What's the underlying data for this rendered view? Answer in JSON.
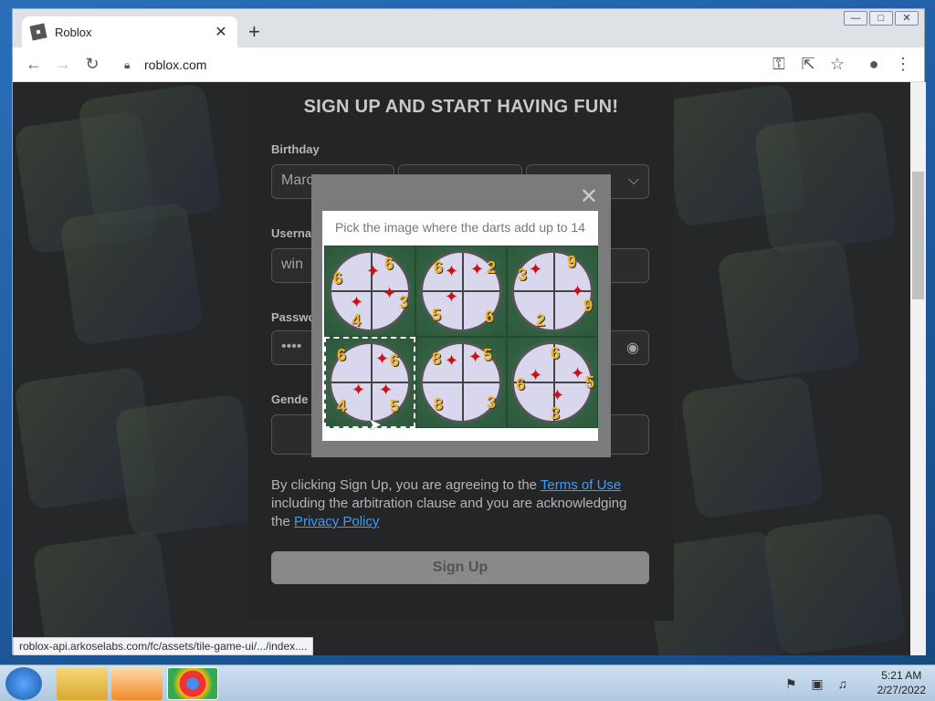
{
  "browser": {
    "tab_title": "Roblox",
    "url": "roblox.com",
    "status_url": "roblox-api.arkoselabs.com/fc/assets/tile-game-ui/.../index...."
  },
  "signup": {
    "heading": "SIGN UP AND START HAVING FUN!",
    "birthday_label": "Birthday",
    "birthday_month": "Marc",
    "username_label": "Userna",
    "username_value": "win",
    "password_label": "Passwo",
    "password_value": "••••",
    "gender_label": "Gende",
    "terms_before": "By clicking Sign Up, you are agreeing to the ",
    "terms_link": "Terms of Use",
    "terms_mid": " including the arbitration clause and you are acknowledging the ",
    "privacy_link": "Privacy Policy",
    "signup_button": "Sign Up"
  },
  "captcha": {
    "prompt": "Pick the image where the darts add up to 14",
    "close": "✕",
    "tiles": [
      {
        "numbers": [
          "6",
          "6",
          "3",
          "4"
        ]
      },
      {
        "numbers": [
          "6",
          "2",
          "5",
          "6"
        ]
      },
      {
        "numbers": [
          "3",
          "9",
          "9",
          "2"
        ]
      },
      {
        "numbers": [
          "6",
          "6",
          "4",
          "5"
        ]
      },
      {
        "numbers": [
          "8",
          "5",
          "8",
          "3"
        ]
      },
      {
        "numbers": [
          "6",
          "6",
          "5",
          "3"
        ]
      }
    ]
  },
  "taskbar": {
    "time": "5:21 AM",
    "date": "2/27/2022"
  }
}
